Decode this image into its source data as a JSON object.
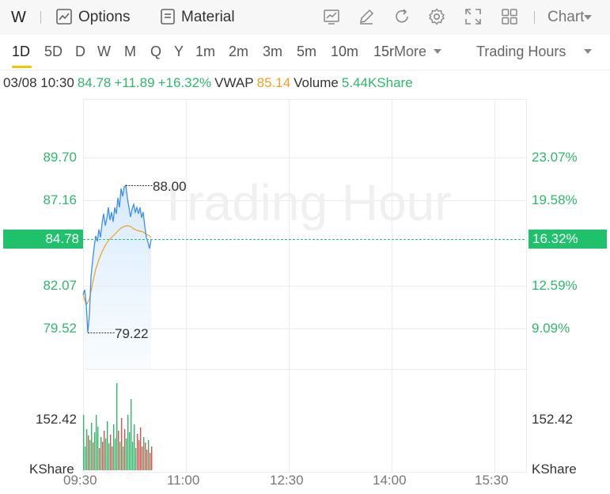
{
  "toolbar": {
    "symbol": "W",
    "options_label": "Options",
    "material_label": "Material",
    "chart_label": "Chart",
    "icons": [
      "options-chart-icon",
      "material-doc-icon",
      "indicator-chart-icon",
      "draw-pen-icon",
      "refresh-icon",
      "settings-gear-icon",
      "fullscreen-icon",
      "layout-grid-icon",
      "chevron-down-icon"
    ]
  },
  "timeframes": {
    "items": [
      "1D",
      "5D",
      "D",
      "W",
      "M",
      "Q",
      "Y",
      "1m",
      "2m",
      "3m",
      "5m",
      "10m",
      "15r"
    ],
    "active": "1D",
    "more_label": "More",
    "session_label": "Trading Hours"
  },
  "info": {
    "datetime": "03/08 10:30",
    "price": "84.78",
    "change": "+11.89",
    "change_pct": "+16.32%",
    "vwap_label": "VWAP",
    "vwap_value": "85.14",
    "volume_label": "Volume",
    "volume_value": "5.44KShare"
  },
  "chart": {
    "watermark": "Trading Hour",
    "left_axis": [
      "89.70",
      "87.16",
      "82.07",
      "79.52"
    ],
    "right_axis": [
      "23.07%",
      "19.58%",
      "12.59%",
      "9.09%"
    ],
    "current_price_tag": "84.78",
    "current_pct_tag": "16.32%",
    "high_label": "88.00",
    "low_label": "79.22",
    "volume_left_label": "152.42",
    "volume_right_label": "152.42",
    "volume_unit_left": "KShare",
    "volume_unit_right": "KShare",
    "x_labels": [
      "09:30",
      "11:00",
      "12:30",
      "14:00",
      "15:30"
    ]
  },
  "colors": {
    "up": "#2fb86a",
    "vwap": "#f0a020",
    "price_line": "#3b8fe6",
    "accent": "#f5c400",
    "volume_up": "#2fb86a",
    "volume_down": "#e05050"
  }
}
